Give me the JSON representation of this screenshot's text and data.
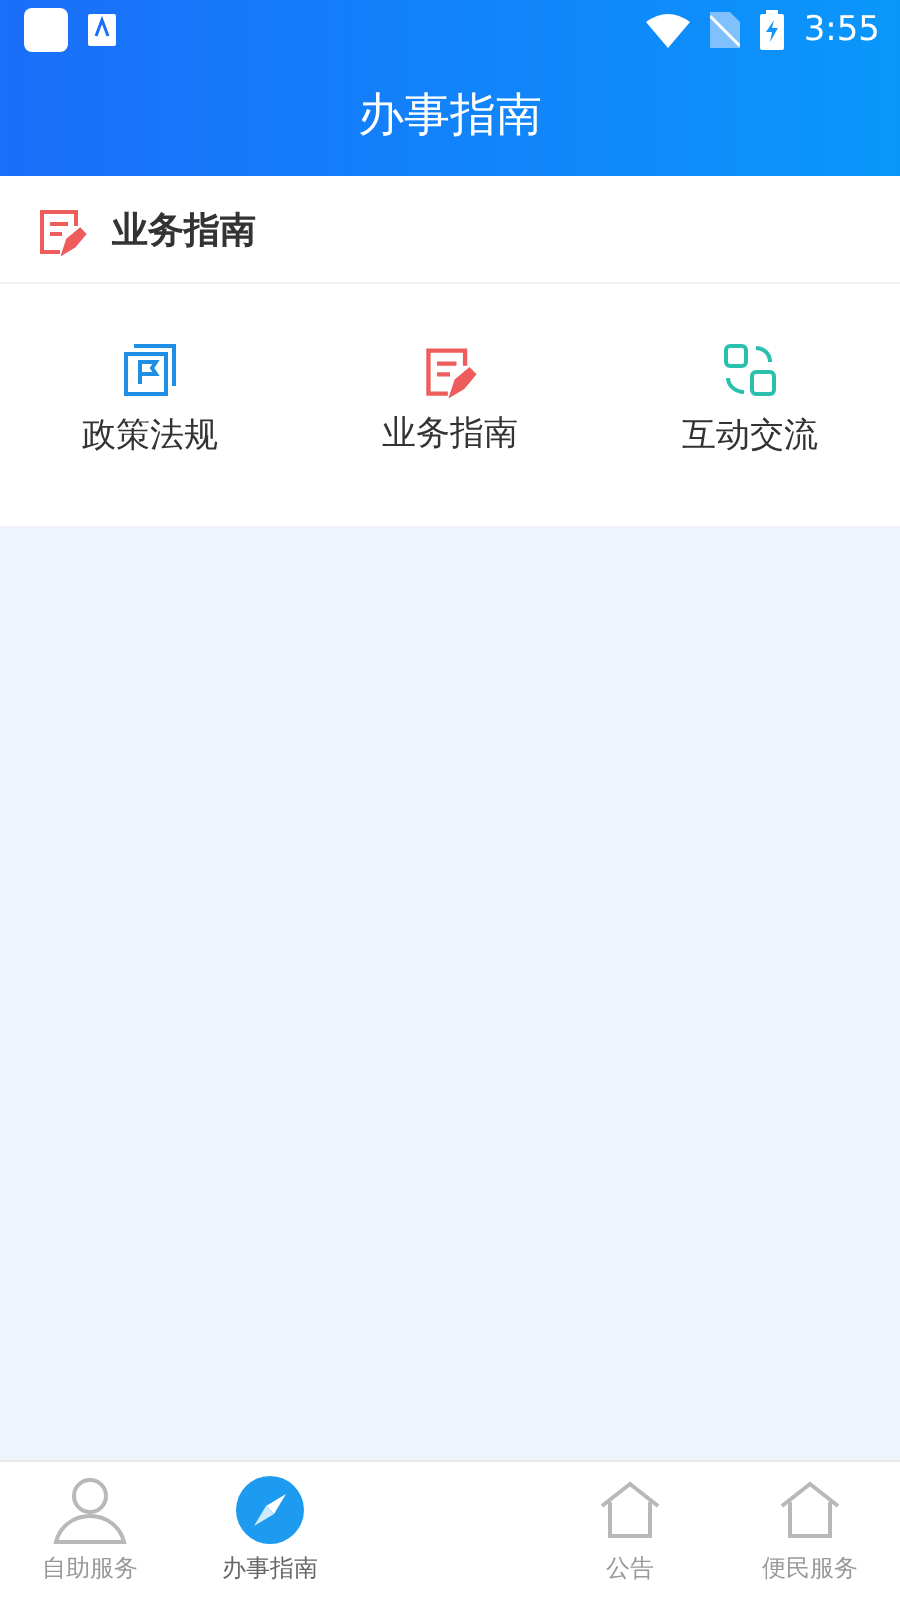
{
  "status_bar": {
    "time": "3:55"
  },
  "header": {
    "title": "办事指南"
  },
  "section": {
    "title": "业务指南"
  },
  "shortcuts": [
    {
      "label": "政策法规",
      "kind": "flag"
    },
    {
      "label": "业务指南",
      "kind": "note"
    },
    {
      "label": "互动交流",
      "kind": "exchange"
    }
  ],
  "bottom_nav": [
    {
      "label": "自助服务",
      "kind": "person",
      "selected": false
    },
    {
      "label": "办事指南",
      "kind": "compass",
      "selected": true
    },
    {
      "label": "公告",
      "kind": "house",
      "selected": false
    },
    {
      "label": "便民服务",
      "kind": "house",
      "selected": false
    }
  ]
}
